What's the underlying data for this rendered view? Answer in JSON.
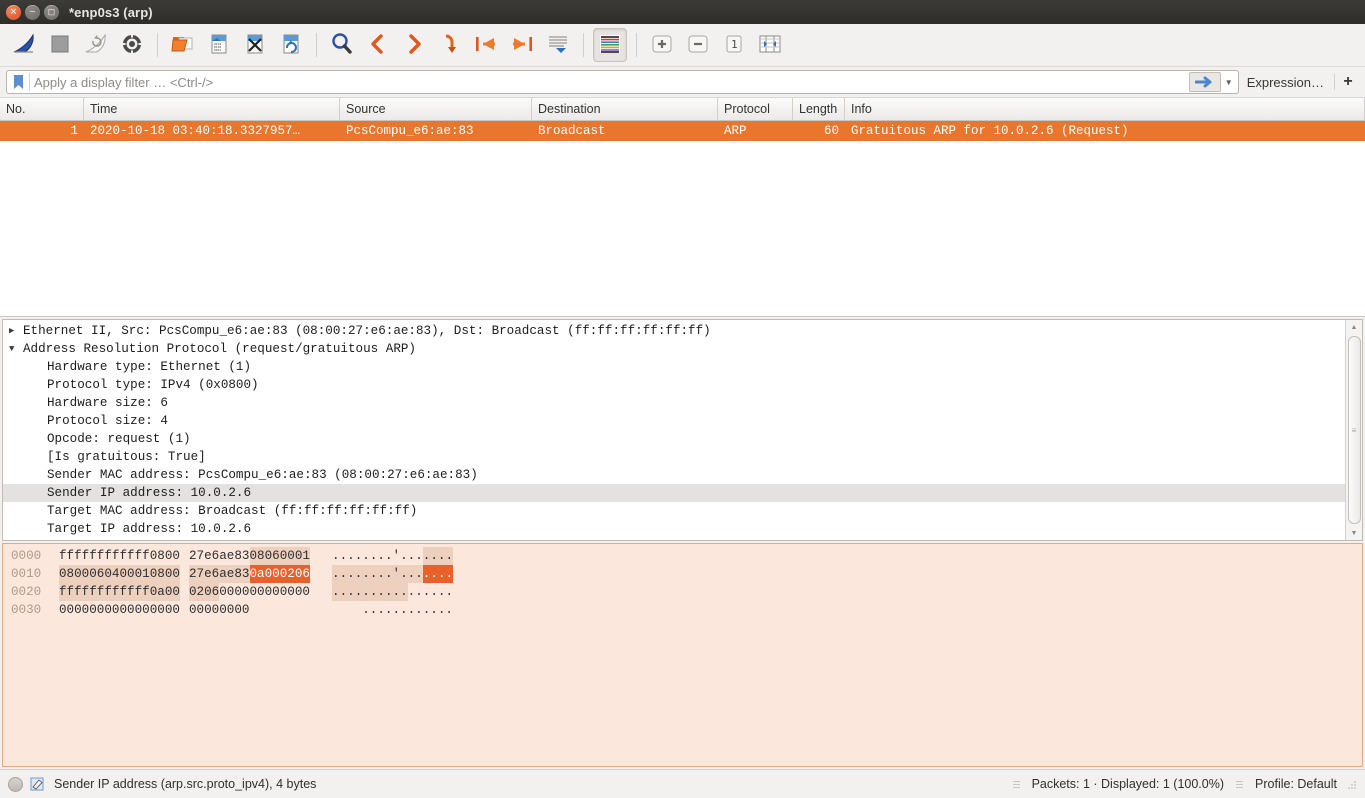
{
  "window": {
    "title": "*enp0s3 (arp)",
    "buttons": {
      "close": "close-button",
      "minimize": "minimize-button",
      "maximize": "maximize-button"
    }
  },
  "toolbar": {
    "items": [
      {
        "name": "start-capture",
        "icon": "shark-fin-icon",
        "label": "Start"
      },
      {
        "name": "stop-capture",
        "icon": "stop-square-icon",
        "label": "Stop"
      },
      {
        "name": "restart-capture",
        "icon": "restart-icon",
        "label": "Restart"
      },
      {
        "name": "capture-options",
        "icon": "gear-icon",
        "label": "Capture options"
      },
      {
        "name": "open-file",
        "icon": "open-folder-icon",
        "label": "Open"
      },
      {
        "name": "save-file",
        "icon": "save-file-icon",
        "label": "Save"
      },
      {
        "name": "close-file",
        "icon": "close-file-icon",
        "label": "Close"
      },
      {
        "name": "reload-file",
        "icon": "reload-file-icon",
        "label": "Reload"
      },
      {
        "name": "find-packet",
        "icon": "magnifier-icon",
        "label": "Find packet"
      },
      {
        "name": "go-back",
        "icon": "back-chevron-icon",
        "label": "Go back"
      },
      {
        "name": "go-forward",
        "icon": "forward-chevron-icon",
        "label": "Go forward"
      },
      {
        "name": "go-to-packet",
        "icon": "goto-packet-icon",
        "label": "Go to packet"
      },
      {
        "name": "go-first-packet",
        "icon": "first-packet-icon",
        "label": "First packet"
      },
      {
        "name": "go-last-packet",
        "icon": "last-packet-icon",
        "label": "Last packet"
      },
      {
        "name": "auto-scroll",
        "icon": "auto-scroll-icon",
        "label": "Auto scroll"
      },
      {
        "name": "colorize-packets",
        "icon": "colorize-icon",
        "label": "Colorize",
        "toggled": true
      },
      {
        "name": "zoom-in",
        "icon": "zoom-in-icon",
        "label": "Zoom in"
      },
      {
        "name": "zoom-out",
        "icon": "zoom-out-icon",
        "label": "Zoom out"
      },
      {
        "name": "zoom-reset",
        "icon": "zoom-reset-icon",
        "label": "Normal size"
      },
      {
        "name": "resize-columns",
        "icon": "resize-columns-icon",
        "label": "Resize columns"
      }
    ]
  },
  "filter": {
    "bookmark_icon": "bookmark-icon",
    "value": "",
    "placeholder": "Apply a display filter … <Ctrl-/>",
    "apply_icon": "apply-arrow-icon",
    "dropdown_icon": "chevron-down-icon",
    "expression_label": "Expression…",
    "add_label": "+"
  },
  "packet_list": {
    "columns": [
      {
        "key": "no",
        "label": "No."
      },
      {
        "key": "time",
        "label": "Time"
      },
      {
        "key": "source",
        "label": "Source"
      },
      {
        "key": "destination",
        "label": "Destination"
      },
      {
        "key": "protocol",
        "label": "Protocol"
      },
      {
        "key": "length",
        "label": "Length"
      },
      {
        "key": "info",
        "label": "Info"
      }
    ],
    "rows": [
      {
        "no": "1",
        "time": "2020-10-18 03:40:18.3327957…",
        "source": "PcsCompu_e6:ae:83",
        "destination": "Broadcast",
        "protocol": "ARP",
        "length": "60",
        "info": "Gratuitous ARP for 10.0.2.6 (Request)",
        "selected": true
      }
    ],
    "selected_row_color": "#e8762c"
  },
  "packet_detail": {
    "rows": [
      {
        "indent": 0,
        "expander": "collapsed",
        "text": "Ethernet II, Src: PcsCompu_e6:ae:83 (08:00:27:e6:ae:83), Dst: Broadcast (ff:ff:ff:ff:ff:ff)"
      },
      {
        "indent": 0,
        "expander": "expanded",
        "text": "Address Resolution Protocol (request/gratuitous ARP)"
      },
      {
        "indent": 1,
        "expander": "none",
        "text": "Hardware type: Ethernet (1)"
      },
      {
        "indent": 1,
        "expander": "none",
        "text": "Protocol type: IPv4 (0x0800)"
      },
      {
        "indent": 1,
        "expander": "none",
        "text": "Hardware size: 6"
      },
      {
        "indent": 1,
        "expander": "none",
        "text": "Protocol size: 4"
      },
      {
        "indent": 1,
        "expander": "none",
        "text": "Opcode: request (1)"
      },
      {
        "indent": 1,
        "expander": "none",
        "text": "[Is gratuitous: True]"
      },
      {
        "indent": 1,
        "expander": "none",
        "text": "Sender MAC address: PcsCompu_e6:ae:83 (08:00:27:e6:ae:83)"
      },
      {
        "indent": 1,
        "expander": "none",
        "text": "Sender IP address: 10.0.2.6",
        "selected": true
      },
      {
        "indent": 1,
        "expander": "none",
        "text": "Target MAC address: Broadcast (ff:ff:ff:ff:ff:ff)"
      },
      {
        "indent": 1,
        "expander": "none",
        "text": "Target IP address: 10.0.2.6"
      }
    ],
    "scrollbar": {
      "up_icon": "scroll-up-arrow-icon",
      "down_icon": "scroll-down-arrow-icon",
      "thumb": "scroll-thumb"
    }
  },
  "hex_dump": {
    "rows": [
      {
        "offset": "0000",
        "bytes": [
          "ff",
          "ff",
          "ff",
          "ff",
          "ff",
          "ff",
          "08",
          "00",
          "27",
          "e6",
          "ae",
          "83",
          "08",
          "06",
          "00",
          "01"
        ],
        "byte_hl": [
          0,
          0,
          0,
          0,
          0,
          0,
          0,
          0,
          0,
          0,
          0,
          0,
          1,
          1,
          1,
          1
        ],
        "ascii": [
          ".",
          ".",
          ".",
          ".",
          ".",
          ".",
          ".",
          ".",
          "'",
          ".",
          ".",
          ".",
          ".",
          ".",
          ".",
          "."
        ],
        "ascii_hl": [
          0,
          0,
          0,
          0,
          0,
          0,
          0,
          0,
          0,
          0,
          0,
          0,
          1,
          1,
          1,
          1
        ]
      },
      {
        "offset": "0010",
        "bytes": [
          "08",
          "00",
          "06",
          "04",
          "00",
          "01",
          "08",
          "00",
          "27",
          "e6",
          "ae",
          "83",
          "0a",
          "00",
          "02",
          "06"
        ],
        "byte_hl": [
          1,
          1,
          1,
          1,
          1,
          1,
          1,
          1,
          1,
          1,
          1,
          1,
          2,
          2,
          2,
          2
        ],
        "ascii": [
          ".",
          ".",
          ".",
          ".",
          ".",
          ".",
          ".",
          ".",
          "'",
          ".",
          ".",
          ".",
          ".",
          ".",
          ".",
          "."
        ],
        "ascii_hl": [
          1,
          1,
          1,
          1,
          1,
          1,
          1,
          1,
          1,
          1,
          1,
          1,
          2,
          2,
          2,
          2
        ]
      },
      {
        "offset": "0020",
        "bytes": [
          "ff",
          "ff",
          "ff",
          "ff",
          "ff",
          "ff",
          "0a",
          "00",
          "02",
          "06",
          "00",
          "00",
          "00",
          "00",
          "00",
          "00"
        ],
        "byte_hl": [
          1,
          1,
          1,
          1,
          1,
          1,
          1,
          1,
          1,
          1,
          0,
          0,
          0,
          0,
          0,
          0
        ],
        "ascii": [
          ".",
          ".",
          ".",
          ".",
          ".",
          ".",
          ".",
          ".",
          ".",
          ".",
          ".",
          ".",
          ".",
          ".",
          ".",
          "."
        ],
        "ascii_hl": [
          1,
          1,
          1,
          1,
          1,
          1,
          1,
          1,
          1,
          1,
          0,
          0,
          0,
          0,
          0,
          0
        ]
      },
      {
        "offset": "0030",
        "bytes": [
          "00",
          "00",
          "00",
          "00",
          "00",
          "00",
          "00",
          "00",
          "00",
          "00",
          "00",
          "00"
        ],
        "byte_hl": [
          0,
          0,
          0,
          0,
          0,
          0,
          0,
          0,
          0,
          0,
          0,
          0
        ],
        "ascii": [
          ".",
          ".",
          ".",
          ".",
          ".",
          ".",
          ".",
          ".",
          ".",
          ".",
          ".",
          "."
        ],
        "ascii_hl": [
          0,
          0,
          0,
          0,
          0,
          0,
          0,
          0,
          0,
          0,
          0,
          0
        ]
      }
    ],
    "selection_color": "#e8602a",
    "background_color": "#fce7dc"
  },
  "status_bar": {
    "expert_icon": "expert-info-circle-icon",
    "capture_comment_icon": "capture-file-comment-icon",
    "field_text": "Sender IP address (arp.src.proto_ipv4), 4 bytes",
    "packets_text": "Packets: 1 · Displayed: 1 (100.0%)",
    "profile_text": "Profile: Default"
  }
}
